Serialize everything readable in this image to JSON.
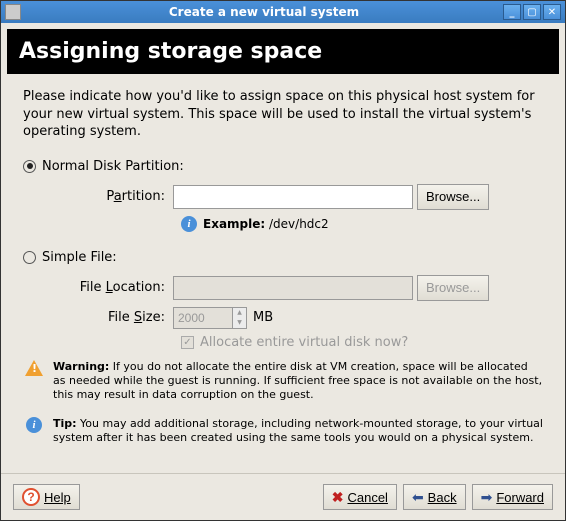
{
  "window": {
    "title": "Create a new virtual system"
  },
  "header": "Assigning storage space",
  "intro": "Please indicate how you'd like to assign space on this physical host system for your new virtual system. This space will be used to install the virtual system's operating system.",
  "option_partition": {
    "label_prefix": "Normal Disk ",
    "label_underlined": "P",
    "label_suffix": "artition:",
    "field_prefix": "P",
    "field_underlined": "a",
    "field_suffix": "rtition:",
    "value": "",
    "browse": "Browse...",
    "example_label": "Example:",
    "example_value": "/dev/hdc2"
  },
  "option_file": {
    "label_prefix": "Simple ",
    "label_underlined": "F",
    "label_suffix": "ile:",
    "location_prefix": "File ",
    "location_underlined": "L",
    "location_suffix": "ocation:",
    "location_value": "",
    "browse": "Browse...",
    "size_prefix": "File ",
    "size_underlined": "S",
    "size_suffix": "ize:",
    "size_value": "2000",
    "size_unit": "MB",
    "allocate_label": "Allocate entire virtual disk now?"
  },
  "warning": {
    "label": "Warning:",
    "text": " If you do not allocate the entire disk at VM creation, space will be allocated as needed while the guest is running. If sufficient free space is not available on the host, this may result in data corruption on the guest."
  },
  "tip": {
    "label": "Tip:",
    "text": " You may add additional storage, including network-mounted storage, to your virtual system after it has been created using the same tools you would on a physical system."
  },
  "footer": {
    "help": "Help",
    "cancel": "Cancel",
    "back": "Back",
    "forward": "Forward"
  }
}
